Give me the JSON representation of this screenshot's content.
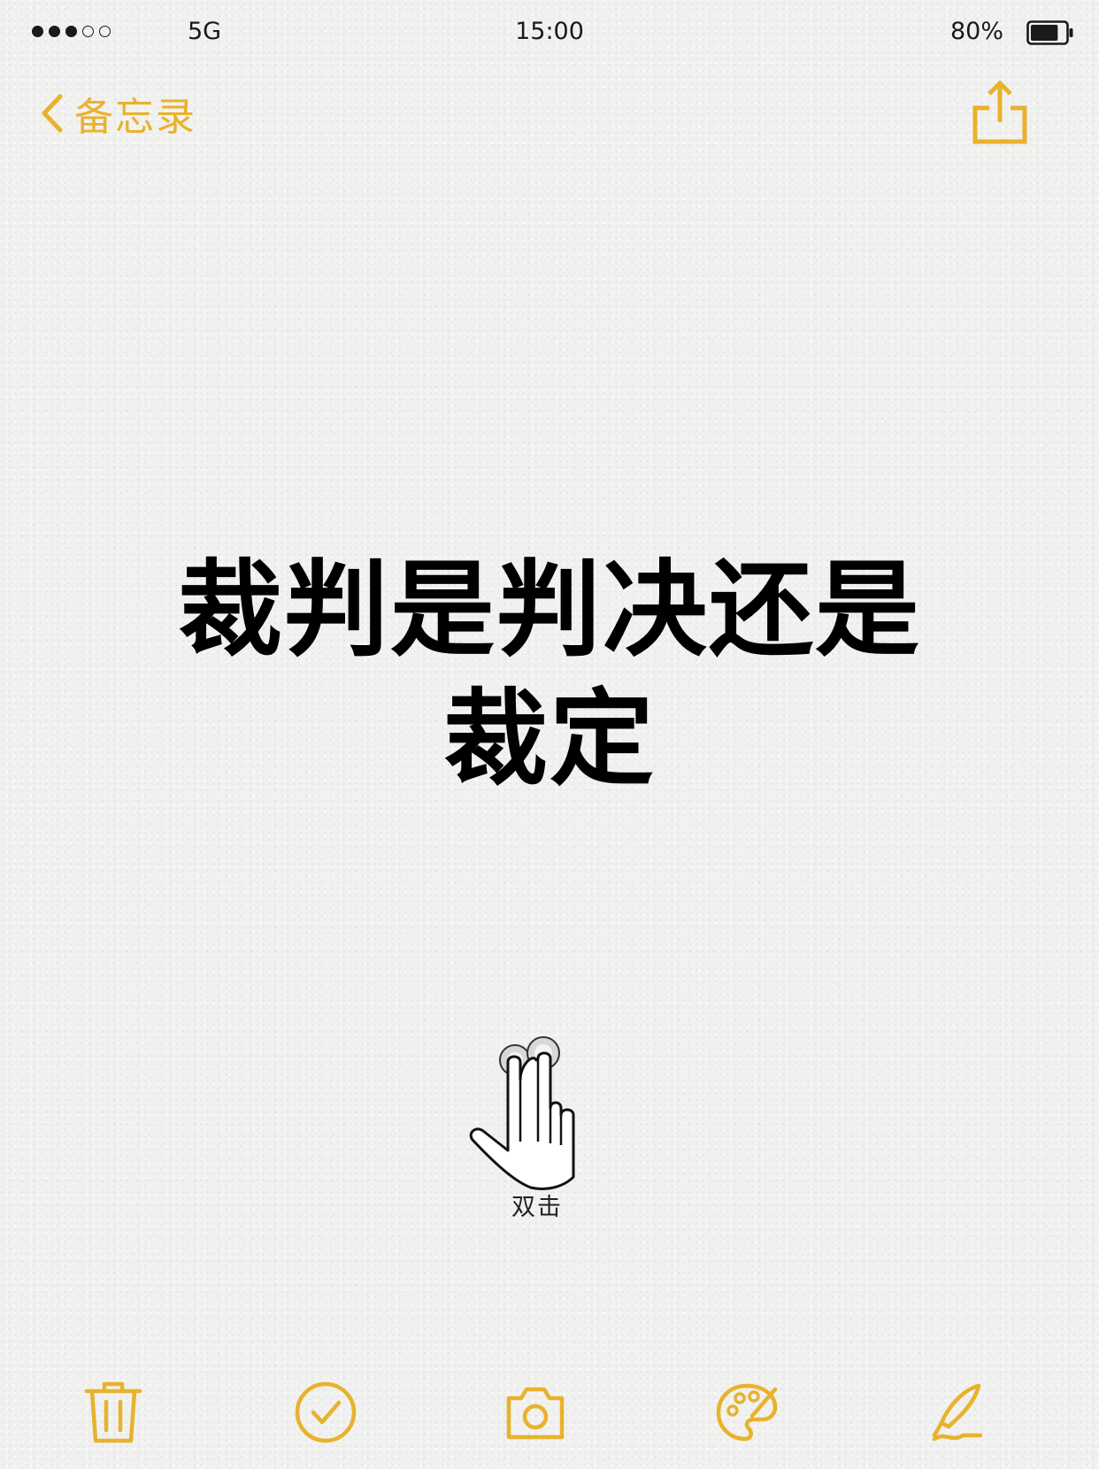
{
  "status_bar": {
    "signal_filled": 3,
    "signal_total": 5,
    "network": "5G",
    "time": "15:00",
    "battery_percent_label": "80%",
    "battery_level": 0.8
  },
  "nav": {
    "back_label": "备忘录",
    "back_icon": "chevron-left-icon",
    "share_icon": "share-icon"
  },
  "note": {
    "title_line1": "裁判是判决还是",
    "title_line2": "裁定"
  },
  "hint": {
    "icon": "double-tap-hand-icon",
    "label": "双击"
  },
  "toolbar": {
    "items": [
      {
        "icon": "trash-icon"
      },
      {
        "icon": "checkmark-circle-icon"
      },
      {
        "icon": "camera-icon"
      },
      {
        "icon": "palette-icon"
      },
      {
        "icon": "pen-icon"
      }
    ]
  },
  "colors": {
    "accent": "#e8b22c",
    "text": "#000000",
    "status_text": "#1a1a1a",
    "background": "#f1f1f0"
  }
}
